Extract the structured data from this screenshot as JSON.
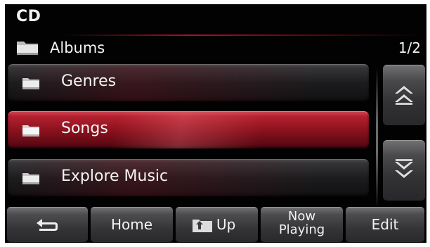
{
  "header": {
    "title": "CD",
    "folder_label": "Albums",
    "page_indicator": "1/2"
  },
  "list": {
    "items": [
      {
        "label": "Genres",
        "icon": "folder-icon",
        "selected": false
      },
      {
        "label": "Songs",
        "icon": "folder-icon",
        "selected": true
      },
      {
        "label": "Explore Music",
        "icon": "folder-icon",
        "selected": false
      }
    ]
  },
  "scroll": {
    "up_icon": "double-chevron-up-icon",
    "down_icon": "double-chevron-down-icon"
  },
  "bottom_bar": {
    "back_icon": "back-arrow-icon",
    "home_label": "Home",
    "up_label": "Up",
    "up_icon": "folder-up-icon",
    "now_playing_line1": "Now",
    "now_playing_line2": "Playing",
    "edit_label": "Edit"
  },
  "colors": {
    "background": "#020202",
    "selected_item": "#a0141f",
    "text": "#f2f2f2"
  }
}
